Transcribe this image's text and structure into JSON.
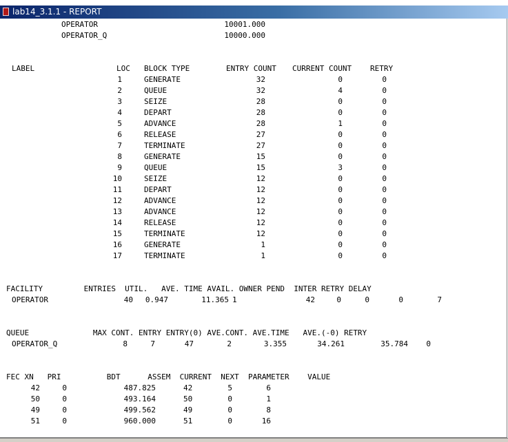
{
  "window": {
    "title": "lab14_3.1.1 - REPORT"
  },
  "storages": [
    {
      "name": "OPERATOR",
      "value": "10001.000"
    },
    {
      "name": "OPERATOR_Q",
      "value": "10000.000"
    }
  ],
  "blocks_header": {
    "label": "LABEL",
    "loc": "LOC",
    "block_type": "BLOCK TYPE",
    "entry_count": "ENTRY COUNT",
    "current_count": "CURRENT COUNT",
    "retry": "RETRY"
  },
  "blocks": [
    {
      "loc": "1",
      "type": "GENERATE",
      "entry": "32",
      "current": "0",
      "retry": "0"
    },
    {
      "loc": "2",
      "type": "QUEUE",
      "entry": "32",
      "current": "4",
      "retry": "0"
    },
    {
      "loc": "3",
      "type": "SEIZE",
      "entry": "28",
      "current": "0",
      "retry": "0"
    },
    {
      "loc": "4",
      "type": "DEPART",
      "entry": "28",
      "current": "0",
      "retry": "0"
    },
    {
      "loc": "5",
      "type": "ADVANCE",
      "entry": "28",
      "current": "1",
      "retry": "0"
    },
    {
      "loc": "6",
      "type": "RELEASE",
      "entry": "27",
      "current": "0",
      "retry": "0"
    },
    {
      "loc": "7",
      "type": "TERMINATE",
      "entry": "27",
      "current": "0",
      "retry": "0"
    },
    {
      "loc": "8",
      "type": "GENERATE",
      "entry": "15",
      "current": "0",
      "retry": "0"
    },
    {
      "loc": "9",
      "type": "QUEUE",
      "entry": "15",
      "current": "3",
      "retry": "0"
    },
    {
      "loc": "10",
      "type": "SEIZE",
      "entry": "12",
      "current": "0",
      "retry": "0"
    },
    {
      "loc": "11",
      "type": "DEPART",
      "entry": "12",
      "current": "0",
      "retry": "0"
    },
    {
      "loc": "12",
      "type": "ADVANCE",
      "entry": "12",
      "current": "0",
      "retry": "0"
    },
    {
      "loc": "13",
      "type": "ADVANCE",
      "entry": "12",
      "current": "0",
      "retry": "0"
    },
    {
      "loc": "14",
      "type": "RELEASE",
      "entry": "12",
      "current": "0",
      "retry": "0"
    },
    {
      "loc": "15",
      "type": "TERMINATE",
      "entry": "12",
      "current": "0",
      "retry": "0"
    },
    {
      "loc": "16",
      "type": "GENERATE",
      "entry": "1",
      "current": "0",
      "retry": "0"
    },
    {
      "loc": "17",
      "type": "TERMINATE",
      "entry": "1",
      "current": "0",
      "retry": "0"
    }
  ],
  "facility": {
    "header": "FACILITY         ENTRIES  UTIL.   AVE. TIME AVAIL. OWNER PEND  INTER RETRY DELAY",
    "row": {
      "name": "OPERATOR",
      "entries": "40",
      "util": "0.947",
      "ave_time": "11.365",
      "avail": "1",
      "owner": "42",
      "pend": "0",
      "inter": "0",
      "retry": "0",
      "delay": "7"
    }
  },
  "queue": {
    "header": "QUEUE              MAX CONT. ENTRY ENTRY(0) AVE.CONT. AVE.TIME   AVE.(-0) RETRY",
    "row": {
      "name": "OPERATOR_Q",
      "max": "8",
      "cont": "7",
      "entry": "47",
      "entry0": "2",
      "ave_cont": "3.355",
      "ave_time": "34.261",
      "ave_0": "35.784",
      "retry": "0"
    }
  },
  "fec": {
    "header": "FEC XN   PRI          BDT      ASSEM  CURRENT  NEXT  PARAMETER    VALUE",
    "rows": [
      {
        "xn": "42",
        "pri": "0",
        "bdt": "487.825",
        "assem": "42",
        "current": "5",
        "next": "6"
      },
      {
        "xn": "50",
        "pri": "0",
        "bdt": "493.164",
        "assem": "50",
        "current": "0",
        "next": "1"
      },
      {
        "xn": "49",
        "pri": "0",
        "bdt": "499.562",
        "assem": "49",
        "current": "0",
        "next": "8"
      },
      {
        "xn": "51",
        "pri": "0",
        "bdt": "960.000",
        "assem": "51",
        "current": "0",
        "next": "16"
      }
    ]
  }
}
